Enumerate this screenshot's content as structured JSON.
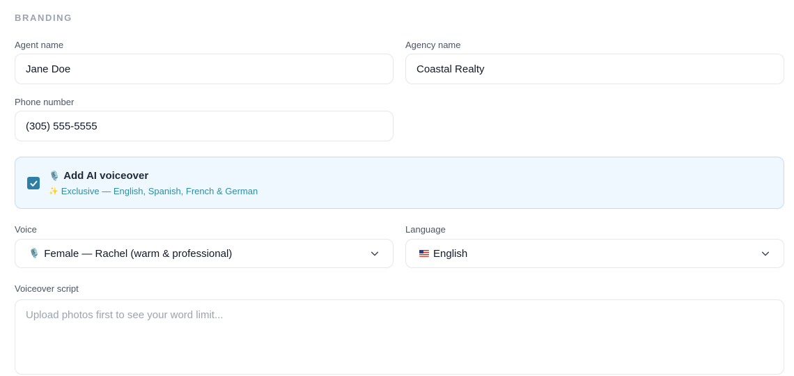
{
  "section": {
    "title": "BRANDING"
  },
  "fields": {
    "agent_name": {
      "label": "Agent name",
      "value": "Jane Doe"
    },
    "agency_name": {
      "label": "Agency name",
      "value": "Coastal Realty"
    },
    "phone_number": {
      "label": "Phone number",
      "value": "(305) 555-5555"
    }
  },
  "voiceover": {
    "checked": true,
    "mic_icon": "🎙️",
    "title": "Add AI voiceover",
    "sparkle_icon": "✨",
    "subtitle": "Exclusive — English, Spanish, French & German",
    "accent_color": "#2f7ea6"
  },
  "voice": {
    "label": "Voice",
    "mic_icon": "🎙️",
    "selected": "Female — Rachel (warm & professional)"
  },
  "language": {
    "label": "Language",
    "flag_icon": "us-flag-icon",
    "selected": "English"
  },
  "script": {
    "label": "Voiceover script",
    "placeholder": "Upload photos first to see your word limit..."
  }
}
